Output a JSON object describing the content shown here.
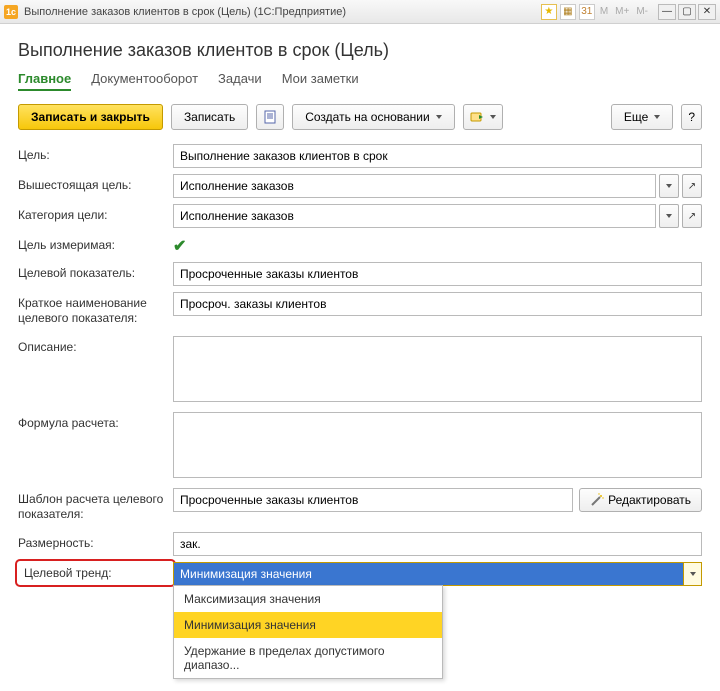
{
  "window": {
    "title": "Выполнение заказов клиентов в срок (Цель)  (1С:Предприятие)",
    "m_buttons": [
      "M",
      "M+",
      "M-"
    ]
  },
  "header": {
    "title": "Выполнение заказов клиентов в срок (Цель)"
  },
  "tabs": {
    "items": [
      {
        "label": "Главное",
        "active": true
      },
      {
        "label": "Документооборот",
        "active": false
      },
      {
        "label": "Задачи",
        "active": false
      },
      {
        "label": "Мои заметки",
        "active": false
      }
    ]
  },
  "toolbar": {
    "save_close": "Записать и закрыть",
    "save": "Записать",
    "create_based": "Создать на основании",
    "more": "Еще",
    "help": "?"
  },
  "form": {
    "goal_label": "Цель:",
    "goal_value": "Выполнение заказов клиентов в срок",
    "parent_goal_label": "Вышестоящая цель:",
    "parent_goal_value": "Исполнение заказов",
    "category_label": "Категория цели:",
    "category_value": "Исполнение заказов",
    "measurable_label": "Цель измеримая:",
    "measurable_checked": true,
    "indicator_label": "Целевой показатель:",
    "indicator_value": "Просроченные заказы клиентов",
    "short_name_label": "Краткое наименование целевого показателя:",
    "short_name_value": "Просроч. заказы клиентов",
    "description_label": "Описание:",
    "description_value": "",
    "formula_label": "Формула расчета:",
    "formula_value": "",
    "template_label": "Шаблон расчета целевого показателя:",
    "template_value": "Просроченные заказы клиентов",
    "template_edit": "Редактировать",
    "dimension_label": "Размерность:",
    "dimension_value": "зак.",
    "trend_label": "Целевой тренд:",
    "trend_value": "Минимизация значения",
    "trend_options": [
      "Максимизация значения",
      "Минимизация значения",
      "Удержание в пределах допустимого диапазо..."
    ]
  }
}
